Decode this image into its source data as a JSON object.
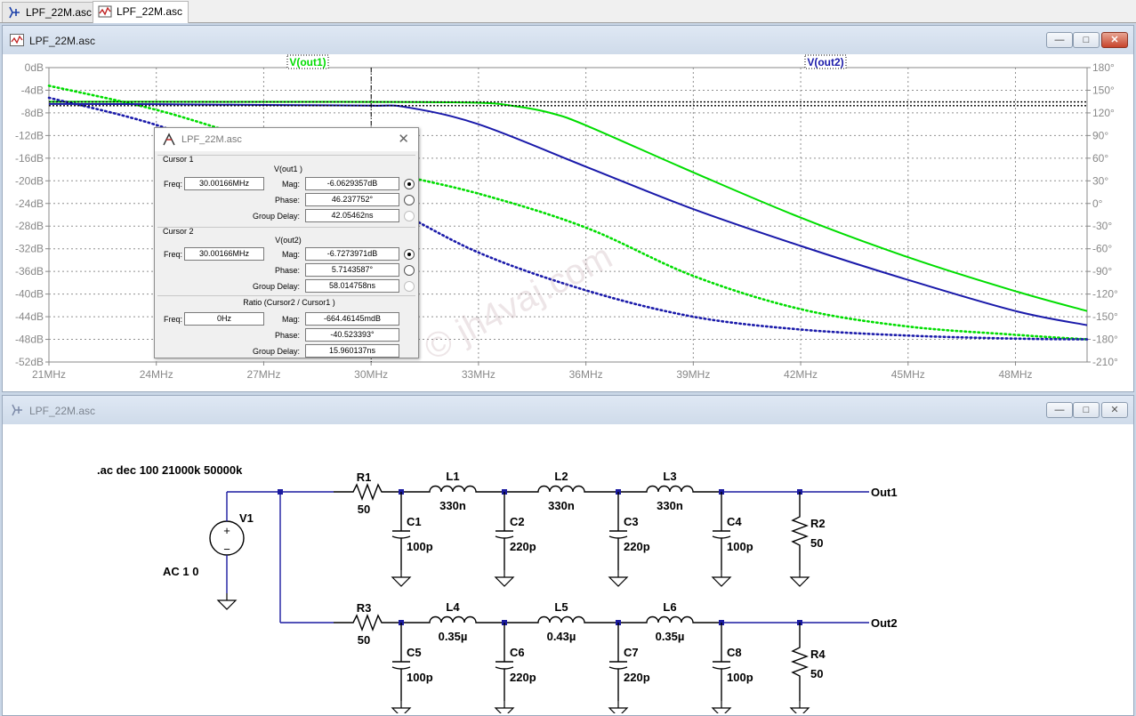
{
  "tabs": [
    {
      "label": "LPF_22M.asc",
      "icon": "schematic-icon"
    },
    {
      "label": "LPF_22M.asc",
      "icon": "waveform-icon"
    }
  ],
  "waveform_window": {
    "title": "LPF_22M.asc",
    "buttons": [
      "minimize",
      "maximize",
      "close"
    ]
  },
  "schematic_window": {
    "title": "LPF_22M.asc",
    "buttons": [
      "minimize",
      "maximize",
      "close"
    ]
  },
  "chart_data": {
    "type": "line",
    "legend": [
      "V(out1)",
      "V(out2)"
    ],
    "legend_colors": {
      "V(out1)": "#00dd00",
      "V(out2)": "#1a1aaa"
    },
    "x_ticks": [
      "21MHz",
      "24MHz",
      "27MHz",
      "30MHz",
      "33MHz",
      "36MHz",
      "39MHz",
      "42MHz",
      "45MHz",
      "48MHz"
    ],
    "y_left_ticks": [
      "0dB",
      "-4dB",
      "-8dB",
      "-12dB",
      "-16dB",
      "-20dB",
      "-24dB",
      "-28dB",
      "-32dB",
      "-36dB",
      "-40dB",
      "-44dB",
      "-48dB",
      "-52dB"
    ],
    "y_right_ticks": [
      "180°",
      "150°",
      "120°",
      "90°",
      "60°",
      "30°",
      "0°",
      "-30°",
      "-60°",
      "-90°",
      "-120°",
      "-150°",
      "-180°",
      "-210°"
    ],
    "xlim_mhz": [
      21,
      50
    ],
    "ylim_db": [
      -52,
      0
    ],
    "ylim_deg": [
      -210,
      180
    ],
    "cursor_x_mhz": 30.00166,
    "series": [
      {
        "name": "V(out1)",
        "kind": "magnitude",
        "unit": "dB",
        "x": [
          21,
          24,
          27,
          30,
          33,
          34,
          35,
          36,
          39,
          42,
          45,
          48,
          50
        ],
        "y": [
          -6.03,
          -6.04,
          -6.05,
          -6.06,
          -6.2,
          -6.8,
          -8.0,
          -10.2,
          -18.5,
          -26.5,
          -33.5,
          -39.5,
          -43.0
        ]
      },
      {
        "name": "V(out1)",
        "kind": "phase",
        "unit": "deg",
        "x": [
          21,
          24,
          27,
          30,
          33,
          36,
          39,
          42,
          45,
          48,
          50
        ],
        "y": [
          156,
          124,
          82,
          46,
          13,
          -32,
          -96,
          -140,
          -163,
          -174,
          -180
        ]
      },
      {
        "name": "V(out2)",
        "kind": "magnitude",
        "unit": "dB",
        "x": [
          21,
          24,
          27,
          30,
          31,
          33,
          36,
          39,
          42,
          45,
          48,
          50
        ],
        "y": [
          -6.42,
          -6.45,
          -6.6,
          -6.73,
          -7.0,
          -10.0,
          -17.5,
          -25.0,
          -31.5,
          -37.5,
          -43.0,
          -45.5
        ]
      },
      {
        "name": "V(out2)",
        "kind": "phase",
        "unit": "deg",
        "x": [
          21,
          24,
          27,
          30,
          33,
          36,
          39,
          42,
          45,
          48,
          50
        ],
        "y": [
          140,
          104,
          50,
          5.7,
          -65,
          -115,
          -150,
          -167,
          -175,
          -179,
          -180
        ]
      }
    ]
  },
  "cursor_dialog": {
    "title": "LPF_22M.asc",
    "cursor1": {
      "heading": "Cursor 1",
      "trace": "V(out1 )",
      "freq_label": "Freq:",
      "freq": "30.00166MHz",
      "mag_label": "Mag:",
      "mag": "-6.0629357dB",
      "phase_label": "Phase:",
      "phase": "46.237752°",
      "gd_label": "Group Delay:",
      "gd": "42.05462ns"
    },
    "cursor2": {
      "heading": "Cursor 2",
      "trace": "V(out2)",
      "freq_label": "Freq:",
      "freq": "30.00166MHz",
      "mag_label": "Mag:",
      "mag": "-6.7273971dB",
      "phase_label": "Phase:",
      "phase": "5.7143587°",
      "gd_label": "Group Delay:",
      "gd": "58.014758ns"
    },
    "ratio": {
      "heading": "Ratio (Cursor2 / Cursor1 )",
      "freq_label": "Freq:",
      "freq": "0Hz",
      "mag_label": "Mag:",
      "mag": "-664.46145mdB",
      "phase_label": "Phase:",
      "phase": "-40.523393°",
      "gd_label": "Group Delay:",
      "gd": "15.960137ns"
    }
  },
  "watermark": "© jh4vaj.com",
  "schematic": {
    "directive": ".ac dec 100 21000k 50000k",
    "source": {
      "name": "V1",
      "value": "AC 1 0"
    },
    "resistors": [
      {
        "name": "R1",
        "value": "50"
      },
      {
        "name": "R2",
        "value": "50"
      },
      {
        "name": "R3",
        "value": "50"
      },
      {
        "name": "R4",
        "value": "50"
      }
    ],
    "inductors": [
      {
        "name": "L1",
        "value": "330n"
      },
      {
        "name": "L2",
        "value": "330n"
      },
      {
        "name": "L3",
        "value": "330n"
      },
      {
        "name": "L4",
        "value": "0.35µ"
      },
      {
        "name": "L5",
        "value": "0.43µ"
      },
      {
        "name": "L6",
        "value": "0.35µ"
      }
    ],
    "capacitors": [
      {
        "name": "C1",
        "value": "100p"
      },
      {
        "name": "C2",
        "value": "220p"
      },
      {
        "name": "C3",
        "value": "220p"
      },
      {
        "name": "C4",
        "value": "100p"
      },
      {
        "name": "C5",
        "value": "100p"
      },
      {
        "name": "C6",
        "value": "220p"
      },
      {
        "name": "C7",
        "value": "220p"
      },
      {
        "name": "C8",
        "value": "100p"
      }
    ],
    "nets": [
      "Out1",
      "Out2"
    ]
  }
}
